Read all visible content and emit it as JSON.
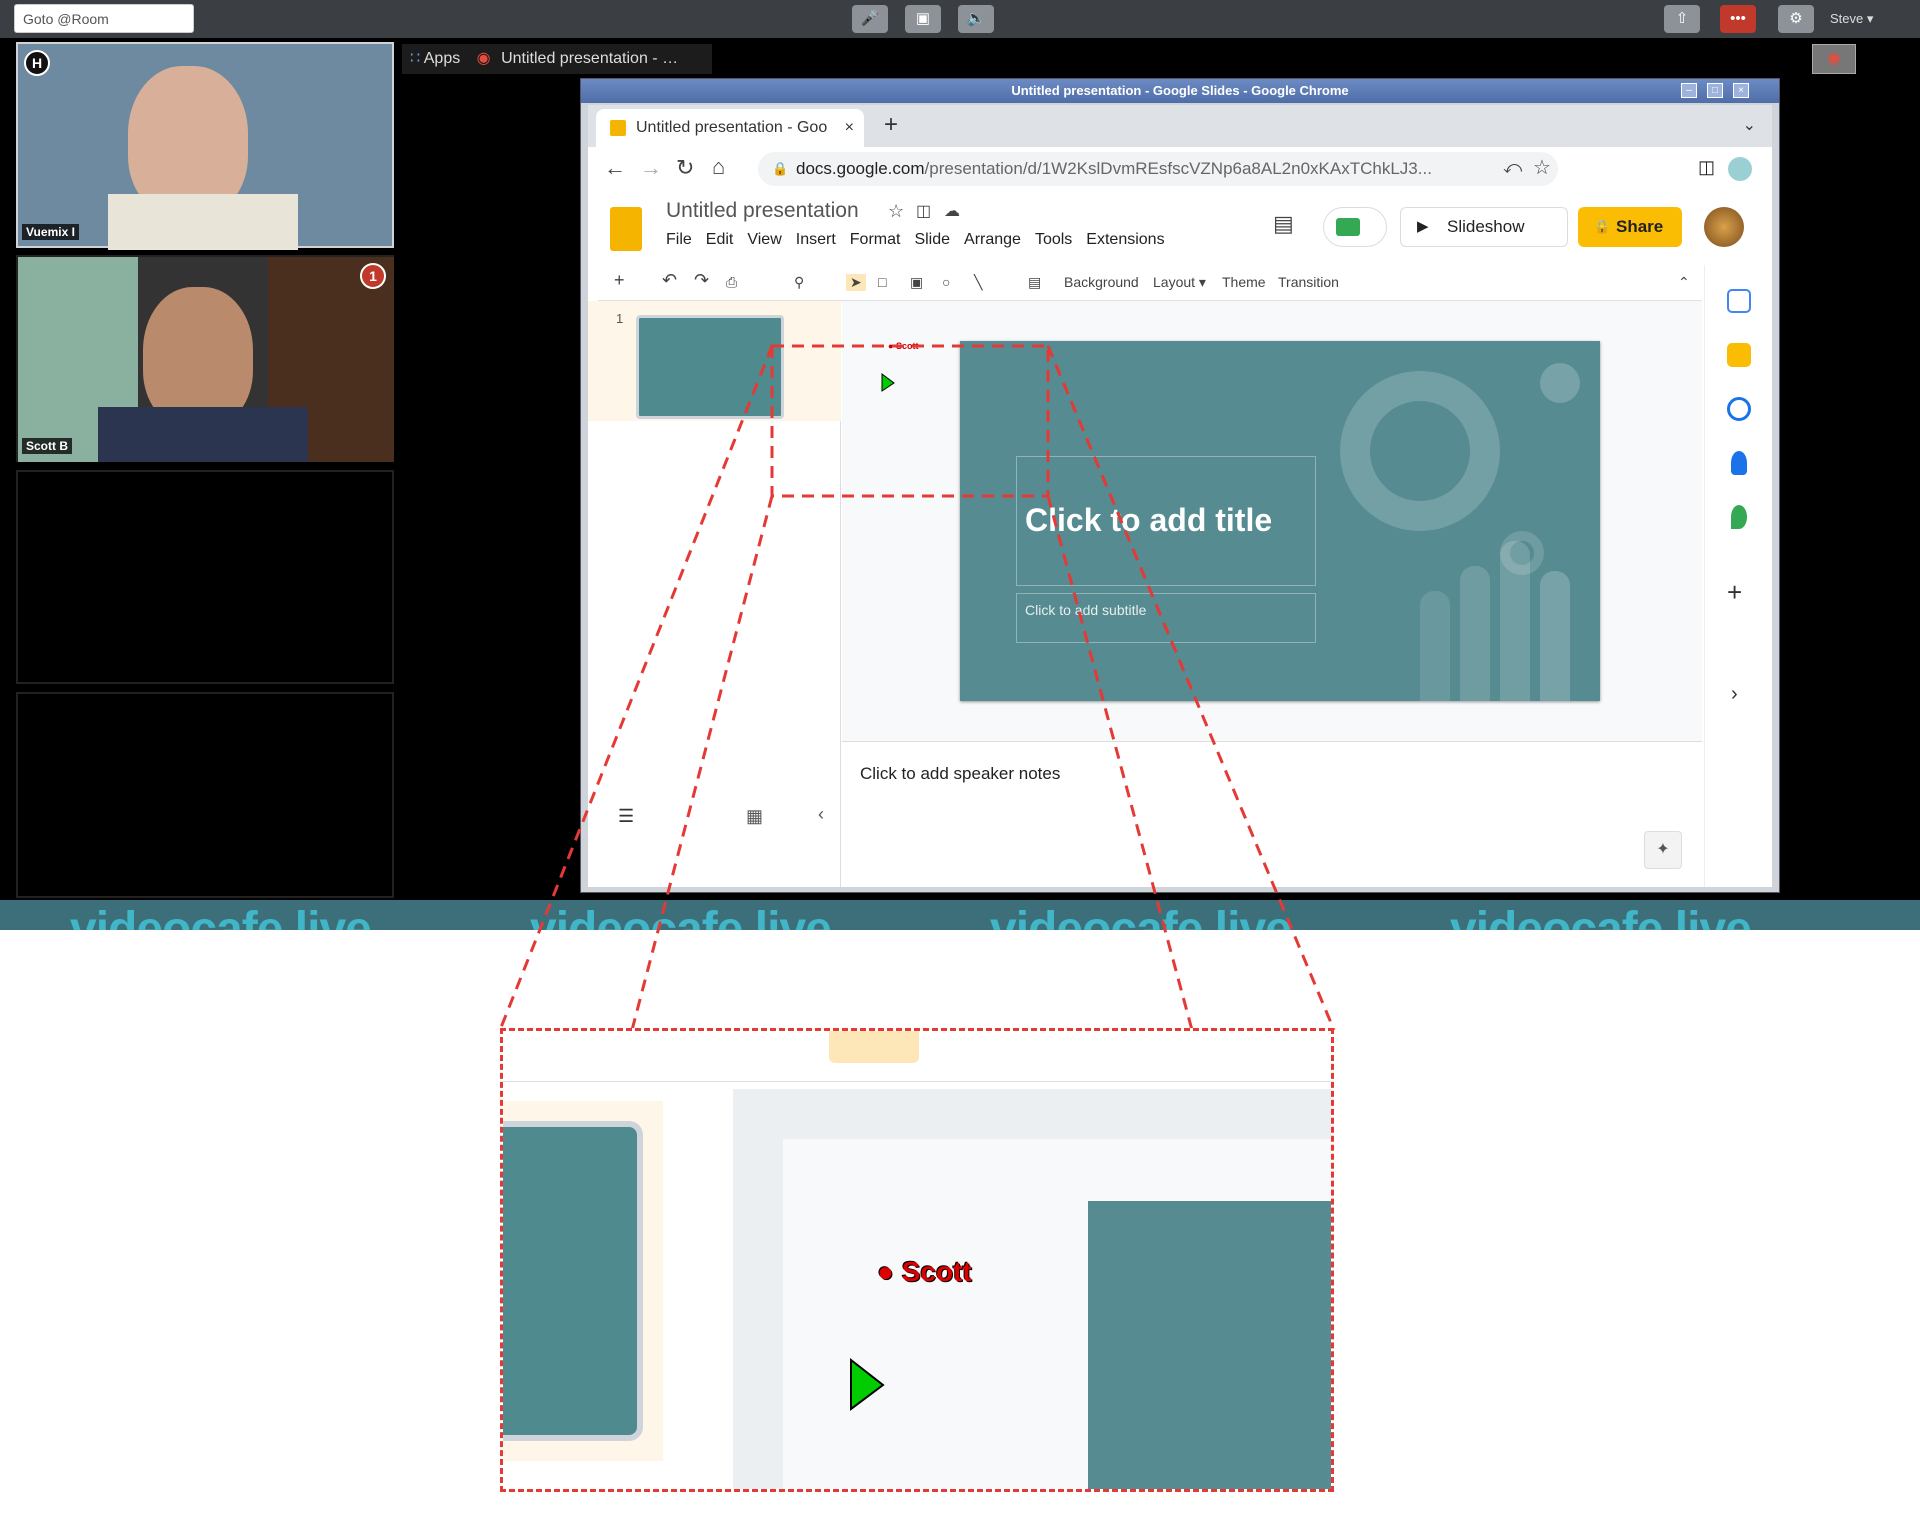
{
  "topbar": {
    "goto_placeholder": "Goto @Room",
    "user": "Steve ▾"
  },
  "participants": [
    {
      "name": "Vuemix I",
      "badge": "H"
    },
    {
      "name": "Scott B",
      "badge": "1"
    }
  ],
  "host_tabs": {
    "apps": "Apps",
    "tab": "Untitled presentation - …"
  },
  "window": {
    "title": "Untitled presentation - Google Slides - Google Chrome"
  },
  "browser": {
    "tab_title": "Untitled presentation - Goo",
    "url_host": "docs.google.com",
    "url_path": "/presentation/d/1W2KslDvmREsfscVZNp6a8AL2n0xKAxTChkLJ3..."
  },
  "slides_app": {
    "doc_title": "Untitled presentation",
    "menus": [
      "File",
      "Edit",
      "View",
      "Insert",
      "Format",
      "Slide",
      "Arrange",
      "Tools",
      "Extensions"
    ],
    "slideshow": "Slideshow",
    "share": "Share",
    "toolbar": {
      "background": "Background",
      "layout": "Layout ▾",
      "theme": "Theme",
      "transition": "Transition"
    },
    "slide_number": "1",
    "title_placeholder": "Click to add title",
    "subtitle_placeholder": "Click to add subtitle",
    "notes_placeholder": "Click to add speaker notes"
  },
  "annotation": {
    "cursor_label": "Scott"
  },
  "watermark": "videocafe live",
  "colors": {
    "slide_teal": "#558b91",
    "share_yellow": "#fbbc04",
    "highlight_red": "#e53935",
    "cursor_green": "#00cc00"
  }
}
